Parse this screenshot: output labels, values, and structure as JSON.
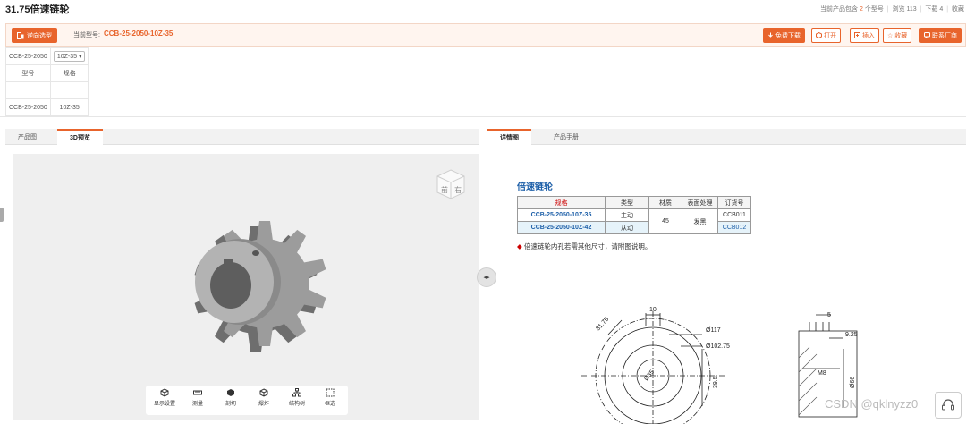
{
  "page": {
    "title": "31.75倍速链轮",
    "stats": {
      "contains_prefix": "当前产品包含",
      "contains_count": "2",
      "contains_suffix": "个型号",
      "views": "浏览 113",
      "downloads": "下载 4",
      "favorites": "收藏"
    }
  },
  "toolbar": {
    "reverse_label": "逆向选型",
    "current_label": "当前型号:",
    "current_model": "CCB-25-2050-10Z-35",
    "buttons": {
      "download": "免费下载",
      "open": "打开",
      "insert": "插入",
      "favorite": "收藏",
      "contact": "联系厂商"
    }
  },
  "spec_table": {
    "select_model": "CCB-25-2050",
    "select_spec": "10Z-35",
    "headers": [
      "型号",
      "规格"
    ],
    "row": [
      "CCB-25-2050",
      "10Z-35"
    ]
  },
  "left_tabs": [
    "产品图",
    "3D预览"
  ],
  "right_tabs": [
    "详情图",
    "产品手册"
  ],
  "viewer_tools": [
    "显示设置",
    "测量",
    "剖切",
    "爆炸",
    "结构树",
    "框选"
  ],
  "viewcube": {
    "front": "前",
    "right": "右"
  },
  "detail": {
    "title": "倍速链轮",
    "headers": [
      "规格",
      "类型",
      "材质",
      "表面处理",
      "订货号"
    ],
    "rows": [
      {
        "spec": "CCB-25-2050-10Z-35",
        "type": "主动",
        "order": "CCB011"
      },
      {
        "spec": "CCB-25-2050-10Z-42",
        "type": "从动",
        "order": "CCB012"
      }
    ],
    "material": "45",
    "surface": "发黑",
    "note": "倍速链轮内孔若需其他尺寸，请附图说明。"
  },
  "drawing": {
    "dims": [
      "10",
      "31.75",
      "Ø117",
      "Ø102.75",
      "Ø35",
      "39.5",
      "5",
      "9.25",
      "M8",
      "Ø66"
    ]
  },
  "watermark": "CSDN @qklnyzz0",
  "colors": {
    "accent": "#e8642c",
    "link_blue": "#1d5fa8",
    "spec_red": "#cc0000"
  }
}
